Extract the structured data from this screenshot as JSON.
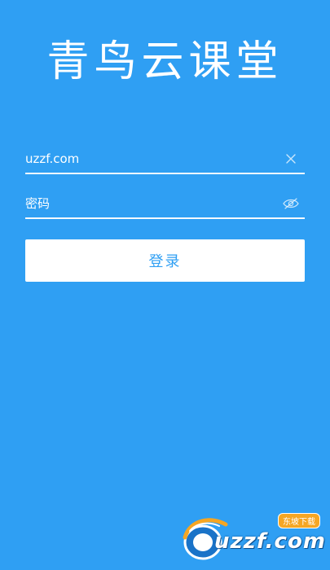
{
  "app": {
    "title": "青鸟云课堂"
  },
  "login": {
    "username_value": "uzzf.com",
    "password_placeholder": "密码",
    "submit_label": "登录"
  },
  "icons": {
    "clear": "close-icon",
    "visibility": "eye-off-icon"
  },
  "watermark": {
    "text": "uzzf.com",
    "tag": "东坡下载"
  },
  "colors": {
    "background": "#2f9ff3",
    "button_bg": "#ffffff",
    "button_text": "#2f9ff3",
    "watermark_accent": "#f5a623"
  }
}
